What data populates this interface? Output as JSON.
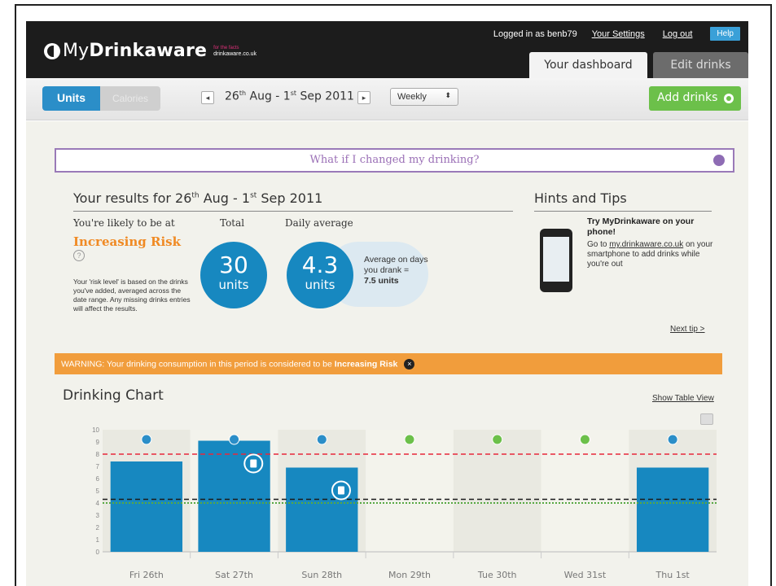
{
  "header": {
    "logo_my": "My",
    "logo_brand": "Drinkaware",
    "logo_sub_top": "for the facts",
    "logo_sub": "drinkaware.co.uk",
    "logged_in": "Logged in as benb79",
    "settings": "Your Settings",
    "logout": "Log out",
    "help": "Help",
    "tab_dashboard": "Your dashboard",
    "tab_edit": "Edit drinks"
  },
  "toolbar": {
    "units": "Units",
    "calories": "Calories",
    "prev": "◂",
    "next": "▸",
    "date_a": "26",
    "date_a_sup": "th",
    "date_b": " Aug - 1",
    "date_b_sup": "st",
    "date_c": " Sep 2011",
    "period": "Weekly",
    "period_caret": "⬍",
    "add": "Add drinks"
  },
  "whatif": "What if I changed my drinking?",
  "results": {
    "title_a": "Your results for 26",
    "title_a_sup": "th",
    "title_b": " Aug - 1",
    "title_b_sup": "st",
    "title_c": " Sep 2011",
    "likely": "You're likely to be at",
    "risk": "Increasing Risk",
    "help_mark": "?",
    "note": "Your 'risk level' is based on the drinks you've added, averaged across the date range. Any missing drinks entries will affect the results.",
    "total_label": "Total",
    "total_value": "30",
    "total_unit": "units",
    "daily_label": "Daily average",
    "daily_value": "4.3",
    "daily_unit": "units",
    "avg_drank": "Average on days you drank =",
    "avg_drank_value": "7.5 units"
  },
  "hints": {
    "title": "Hints and Tips",
    "head": "Try MyDrinkaware on your phone!",
    "body_a": "Go to ",
    "body_link": "my.drinkaware.co.uk",
    "body_b": " on your smartphone to add drinks while you're out",
    "next": "Next tip >"
  },
  "warning": {
    "text": "WARNING: Your drinking consumption in this period is considered to be ",
    "level": "Increasing Risk",
    "close": "×"
  },
  "chart_title": "Drinking Chart",
  "table_view": "Show Table View",
  "chart_data": {
    "type": "bar",
    "categories": [
      "Fri 26th",
      "Sat 27th",
      "Sun 28th",
      "Mon 29th",
      "Tue 30th",
      "Wed 31st",
      "Thu 1st"
    ],
    "values": [
      7.4,
      9.1,
      6.9,
      0,
      0,
      0,
      6.9
    ],
    "day_action": [
      "edit",
      "edit",
      "edit",
      "add",
      "add",
      "add",
      "edit"
    ],
    "notes_on": [
      "Sat 27th",
      "Sun 28th"
    ],
    "ylim": [
      0,
      10
    ],
    "yticks": [
      0,
      1,
      2,
      3,
      4,
      5,
      6,
      7,
      8,
      9,
      10
    ],
    "reference_lines": [
      {
        "value": 8,
        "color": "#e8283a",
        "style": "dashed"
      },
      {
        "value": 4.3,
        "color": "#1a1a1a",
        "style": "dashed"
      },
      {
        "value": 4,
        "color": "#57a843",
        "style": "dotted"
      }
    ],
    "bar_color": "#1788c0"
  }
}
